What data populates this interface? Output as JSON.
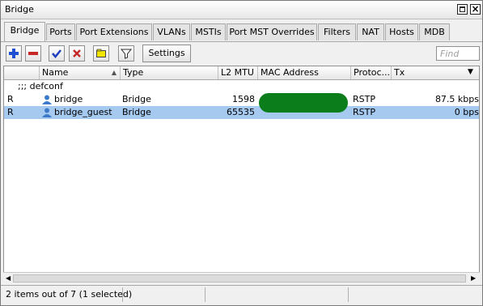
{
  "window": {
    "title": "Bridge"
  },
  "tabs": [
    {
      "label": "Bridge",
      "active": true
    },
    {
      "label": "Ports"
    },
    {
      "label": "Port Extensions"
    },
    {
      "label": "VLANs"
    },
    {
      "label": "MSTIs"
    },
    {
      "label": "Port MST Overrides"
    },
    {
      "label": "Filters"
    },
    {
      "label": "NAT"
    },
    {
      "label": "Hosts"
    },
    {
      "label": "MDB"
    }
  ],
  "toolbar": {
    "settings_label": "Settings",
    "find_placeholder": "Find",
    "icons": [
      "add-icon",
      "remove-icon",
      "enable-icon",
      "disable-icon",
      "comment-icon",
      "filter-icon"
    ],
    "colors": {
      "add": "#1f4fd1",
      "remove": "#c62828",
      "enable": "#1f3fbf",
      "disable": "#c62828",
      "comment": "#f2e600"
    }
  },
  "table": {
    "columns": [
      "Name",
      "Type",
      "L2 MTU",
      "MAC Address",
      "Protoc...",
      "Tx"
    ],
    "group_comment": ";;; defconf",
    "rows": [
      {
        "flag": "R",
        "name": "bridge",
        "type": "Bridge",
        "l2mtu": "1598",
        "mac": "",
        "protocol": "RSTP",
        "tx": "87.5 kbps",
        "selected": false
      },
      {
        "flag": "R",
        "name": "bridge_guest",
        "type": "Bridge",
        "l2mtu": "65535",
        "mac": "",
        "protocol": "RSTP",
        "tx": "0 bps",
        "selected": true
      }
    ]
  },
  "status": {
    "text": "2 items out of 7 (1 selected)"
  }
}
